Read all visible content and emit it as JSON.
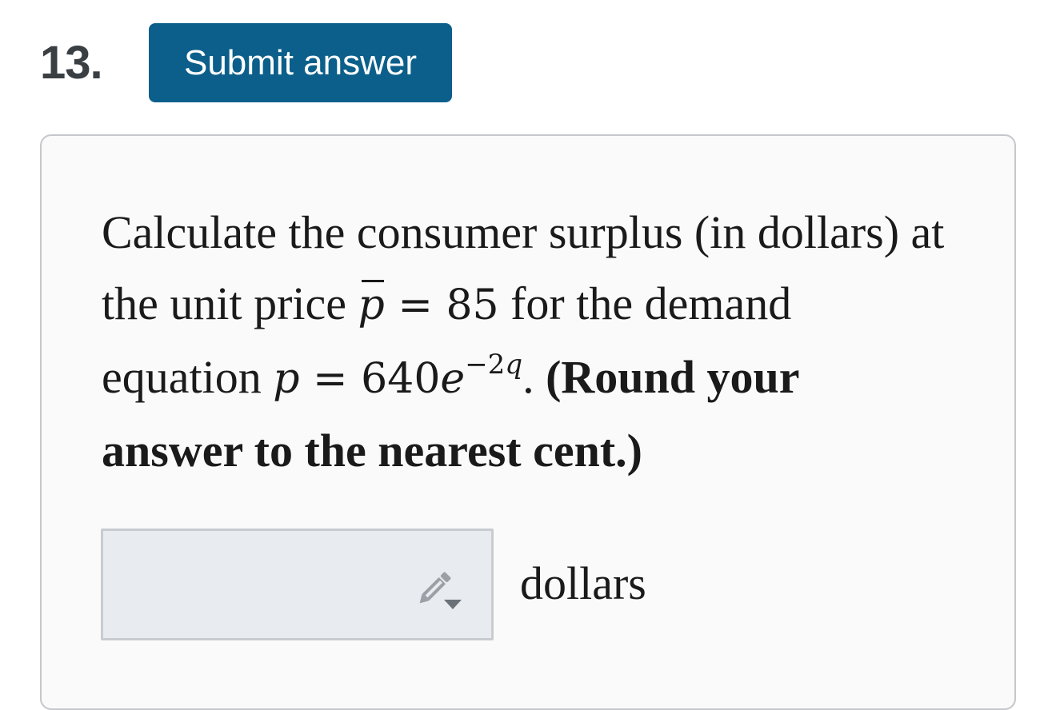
{
  "question": {
    "number": "13.",
    "submit_label": "Submit answer",
    "text_1": "Calculate the consumer surplus (in dollars) at the unit price ",
    "pbar_var": "p",
    "eq_1": " = 85",
    "text_2": " for the demand equation ",
    "p_var": "p",
    "eq_2": " = 640",
    "e_var": "e",
    "exponent_sign": "−2",
    "exponent_var": "q",
    "period": ".",
    "bold_instruction": " (Round your answer to the nearest cent.)"
  },
  "answer": {
    "value": "",
    "unit": "dollars",
    "icon": "pencil-icon"
  },
  "colors": {
    "button_bg": "#0b5f8a",
    "panel_bg": "#fafafa",
    "panel_border": "#c4c7cb",
    "input_bg": "#e8ebef"
  }
}
